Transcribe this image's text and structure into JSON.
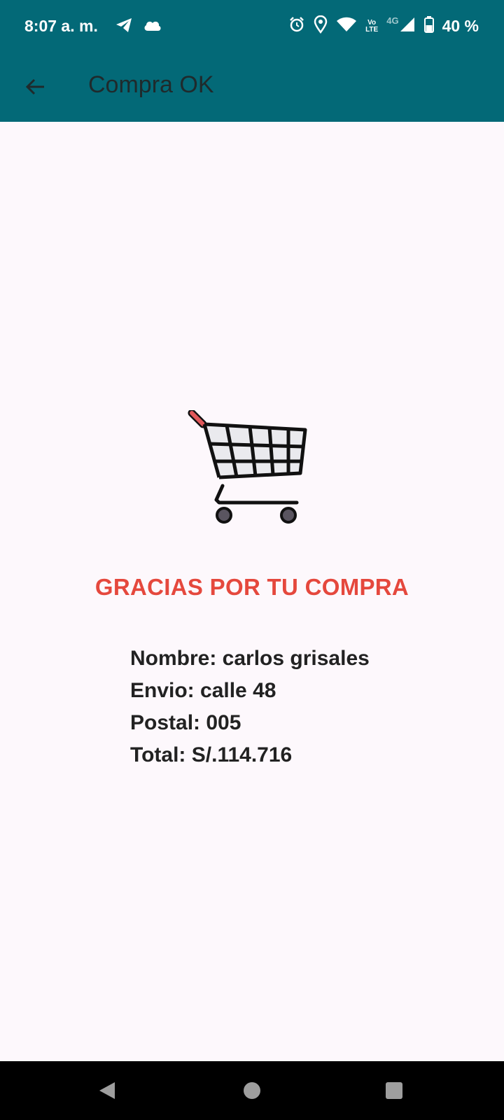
{
  "status_bar": {
    "time": "8:07 a. m.",
    "left_icons": [
      "telegram-icon",
      "cloud-icon"
    ],
    "right_icons": [
      "alarm-icon",
      "location-icon",
      "wifi-icon",
      "volte-icon",
      "signal-icon",
      "battery-icon"
    ],
    "volte_top": "Vo",
    "volte_bottom": "LTE",
    "network": "4G",
    "battery": "40 %"
  },
  "app_bar": {
    "title": "Compra OK",
    "color": "#036977"
  },
  "content": {
    "icon": "shopping-cart-icon",
    "thanks": "GRACIAS POR TU COMPRA",
    "thanks_color": "#e5483d",
    "details": [
      "Nombre: carlos grisales",
      "Envio: calle 48",
      "Postal: 005",
      "Total: S/.114.716"
    ]
  },
  "nav_bar": {
    "buttons": [
      "back-triangle-icon",
      "home-circle-icon",
      "recents-square-icon"
    ]
  }
}
